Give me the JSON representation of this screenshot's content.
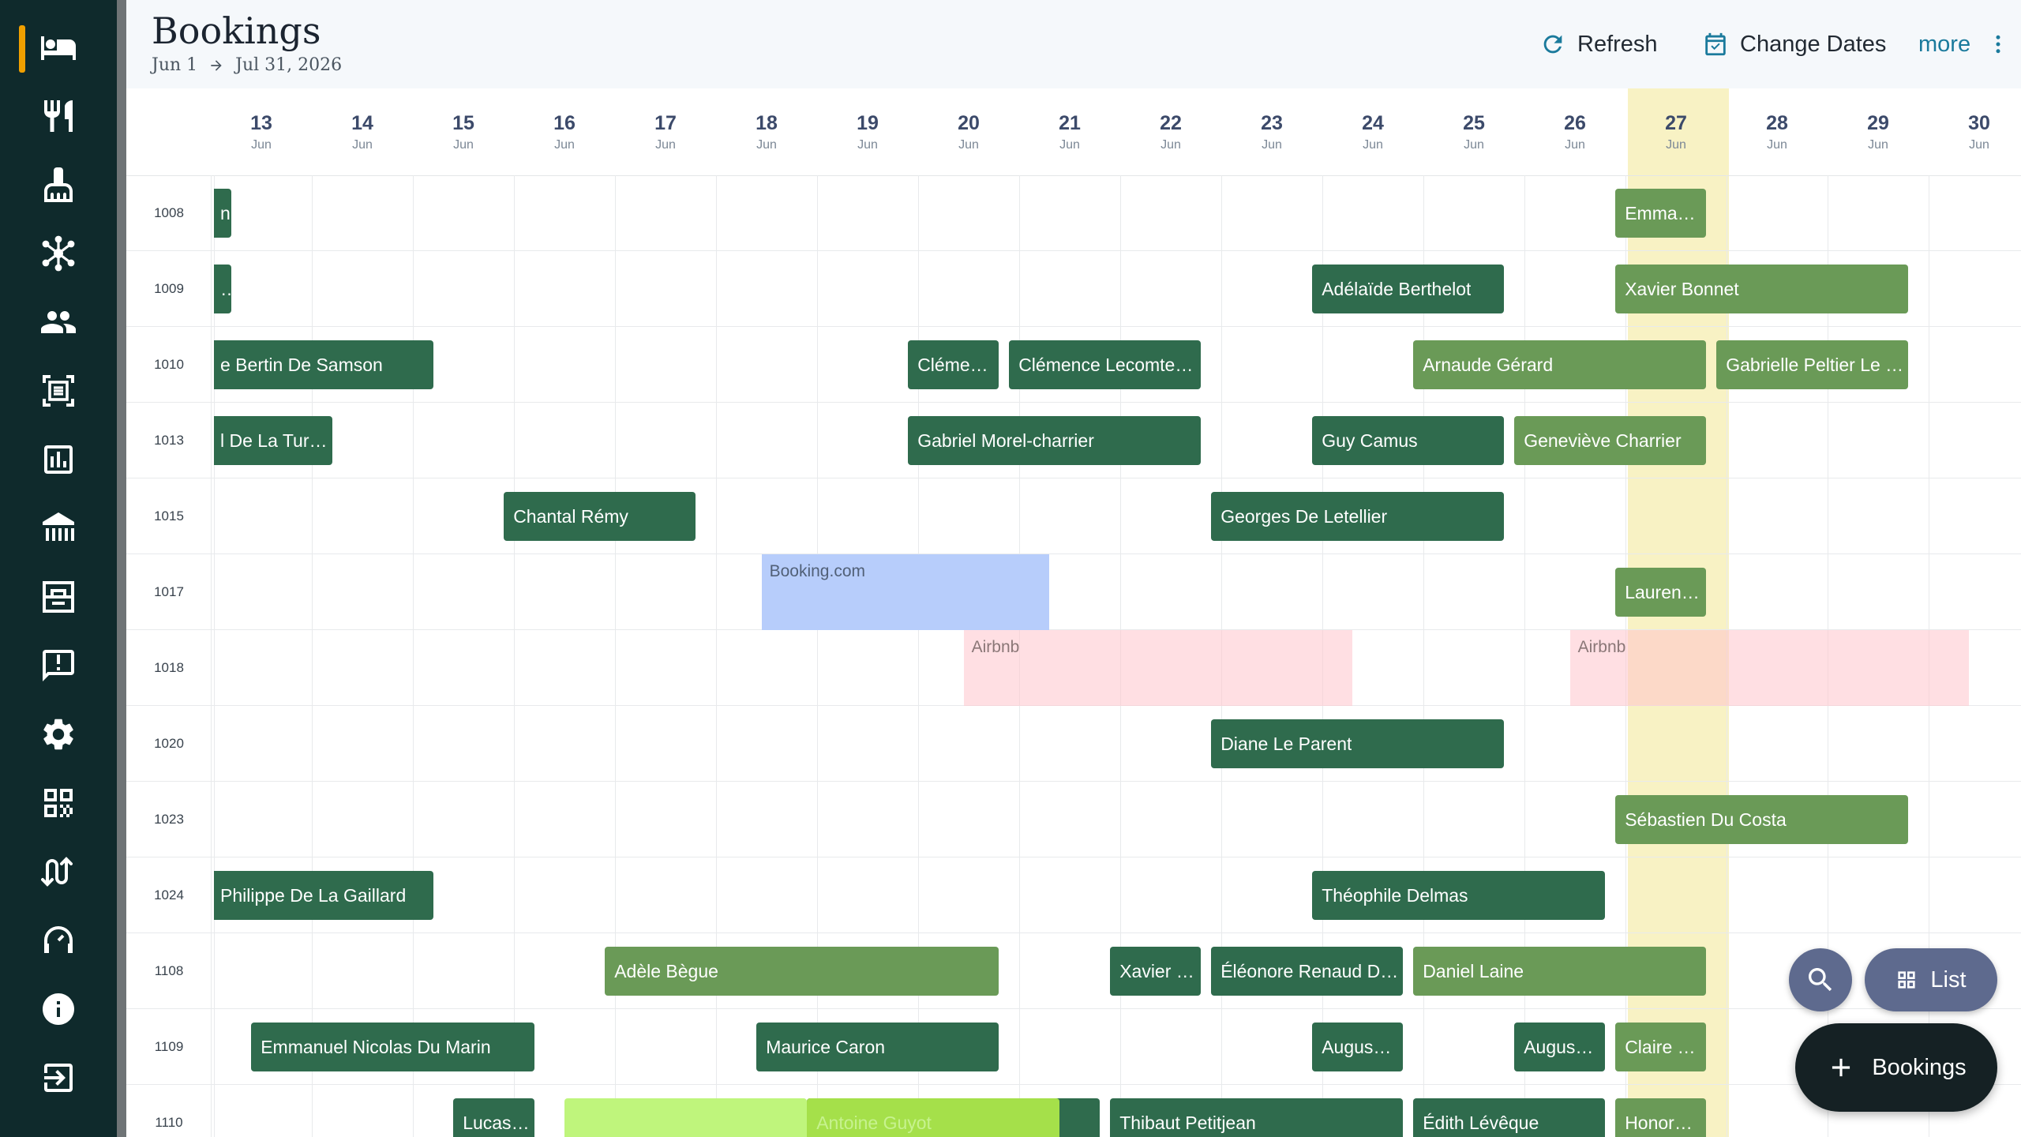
{
  "header": {
    "title": "Bookings",
    "date_start": "Jun 1",
    "date_end": "Jul 31, 2026",
    "refresh_label": "Refresh",
    "change_dates_label": "Change Dates",
    "more_label": "more"
  },
  "sidebar": {
    "items": [
      {
        "icon": "bed-icon",
        "active": true
      },
      {
        "icon": "restaurant-icon"
      },
      {
        "icon": "cleaning-icon"
      },
      {
        "icon": "hub-icon"
      },
      {
        "icon": "guests-icon"
      },
      {
        "icon": "document-scan-icon"
      },
      {
        "icon": "reports-icon"
      },
      {
        "icon": "property-icon"
      },
      {
        "icon": "rooms-icon"
      },
      {
        "icon": "feedback-icon"
      },
      {
        "icon": "settings-icon"
      },
      {
        "icon": "qr-code-icon"
      },
      {
        "icon": "channel-icon"
      },
      {
        "icon": "support-icon"
      },
      {
        "icon": "info-icon"
      },
      {
        "icon": "logout-icon"
      }
    ]
  },
  "days": [
    {
      "num": "13",
      "mon": "Jun"
    },
    {
      "num": "14",
      "mon": "Jun"
    },
    {
      "num": "15",
      "mon": "Jun"
    },
    {
      "num": "16",
      "mon": "Jun"
    },
    {
      "num": "17",
      "mon": "Jun"
    },
    {
      "num": "18",
      "mon": "Jun"
    },
    {
      "num": "19",
      "mon": "Jun"
    },
    {
      "num": "20",
      "mon": "Jun"
    },
    {
      "num": "21",
      "mon": "Jun"
    },
    {
      "num": "22",
      "mon": "Jun"
    },
    {
      "num": "23",
      "mon": "Jun"
    },
    {
      "num": "24",
      "mon": "Jun"
    },
    {
      "num": "25",
      "mon": "Jun"
    },
    {
      "num": "26",
      "mon": "Jun"
    },
    {
      "num": "27",
      "mon": "Jun",
      "today": true
    },
    {
      "num": "28",
      "mon": "Jun"
    },
    {
      "num": "29",
      "mon": "Jun"
    },
    {
      "num": "30",
      "mon": "Jun"
    }
  ],
  "rooms": [
    "1008",
    "1009",
    "1010",
    "1013",
    "1015",
    "1017",
    "1018",
    "1020",
    "1023",
    "1024",
    "1108",
    "1109",
    "1110"
  ],
  "bookings": [
    {
      "row": 0,
      "start": 12.5,
      "end": 12.7,
      "name": "n",
      "style": "dark"
    },
    {
      "row": 0,
      "start": 26.4,
      "end": 27.3,
      "name": "Emma…",
      "style": "light"
    },
    {
      "row": 1,
      "start": 12.5,
      "end": 12.7,
      "name": "…",
      "style": "dark"
    },
    {
      "row": 1,
      "start": 23.4,
      "end": 25.3,
      "name": "Adélaïde Berthelot",
      "style": "dark"
    },
    {
      "row": 1,
      "start": 26.4,
      "end": 29.3,
      "name": "Xavier Bonnet",
      "style": "light"
    },
    {
      "row": 2,
      "start": 12.5,
      "end": 14.7,
      "name": "e Bertin De Samson",
      "style": "dark"
    },
    {
      "row": 2,
      "start": 19.4,
      "end": 20.3,
      "name": "Cléme…",
      "style": "dark"
    },
    {
      "row": 2,
      "start": 20.4,
      "end": 22.3,
      "name": "Clémence Lecomte…",
      "style": "dark"
    },
    {
      "row": 2,
      "start": 24.4,
      "end": 27.3,
      "name": "Arnaude Gérard",
      "style": "light"
    },
    {
      "row": 2,
      "start": 27.4,
      "end": 29.3,
      "name": "Gabrielle Peltier Le …",
      "style": "light"
    },
    {
      "row": 3,
      "start": 12.5,
      "end": 13.7,
      "name": "l De La Turpin",
      "style": "dark"
    },
    {
      "row": 3,
      "start": 19.4,
      "end": 22.3,
      "name": "Gabriel Morel-charrier",
      "style": "dark"
    },
    {
      "row": 3,
      "start": 23.4,
      "end": 25.3,
      "name": "Guy Camus",
      "style": "dark"
    },
    {
      "row": 3,
      "start": 25.4,
      "end": 27.3,
      "name": "Geneviève Charrier",
      "style": "light"
    },
    {
      "row": 4,
      "start": 15.4,
      "end": 17.3,
      "name": "Chantal Rémy",
      "style": "dark"
    },
    {
      "row": 4,
      "start": 22.4,
      "end": 25.3,
      "name": "Georges De Letellier",
      "style": "dark"
    },
    {
      "row": 5,
      "start": 26.4,
      "end": 27.3,
      "name": "Lauren…",
      "style": "light"
    },
    {
      "row": 7,
      "start": 22.4,
      "end": 25.3,
      "name": "Diane Le Parent",
      "style": "dark"
    },
    {
      "row": 8,
      "start": 26.4,
      "end": 29.3,
      "name": "Sébastien Du Costa",
      "style": "light"
    },
    {
      "row": 9,
      "start": 12.5,
      "end": 14.7,
      "name": "Philippe De La Gaillard",
      "style": "dark"
    },
    {
      "row": 9,
      "start": 23.4,
      "end": 26.3,
      "name": "Théophile Delmas",
      "style": "dark"
    },
    {
      "row": 10,
      "start": 16.4,
      "end": 20.3,
      "name": "Adèle Bègue",
      "style": "light"
    },
    {
      "row": 10,
      "start": 21.4,
      "end": 22.3,
      "name": "Xavier …",
      "style": "dark"
    },
    {
      "row": 10,
      "start": 22.4,
      "end": 24.3,
      "name": "Éléonore Renaud D…",
      "style": "dark"
    },
    {
      "row": 10,
      "start": 24.4,
      "end": 27.3,
      "name": "Daniel Laine",
      "style": "light"
    },
    {
      "row": 11,
      "start": 12.9,
      "end": 15.7,
      "name": "Emmanuel Nicolas Du Marin",
      "style": "dark"
    },
    {
      "row": 11,
      "start": 17.9,
      "end": 20.3,
      "name": "Maurice Caron",
      "style": "dark"
    },
    {
      "row": 11,
      "start": 23.4,
      "end": 24.3,
      "name": "Augus…",
      "style": "dark"
    },
    {
      "row": 11,
      "start": 25.4,
      "end": 26.3,
      "name": "Augus…",
      "style": "dark"
    },
    {
      "row": 11,
      "start": 26.4,
      "end": 27.3,
      "name": "Claire …",
      "style": "light"
    },
    {
      "row": 12,
      "start": 14.9,
      "end": 15.7,
      "name": "Lucas-…",
      "style": "dark"
    },
    {
      "row": 12,
      "start": 18.4,
      "end": 21.3,
      "name": "",
      "style": "dark"
    },
    {
      "row": 12,
      "start": 16.0,
      "end": 18.4,
      "name": "",
      "style": "lime2"
    },
    {
      "row": 12,
      "start": 18.4,
      "end": 20.9,
      "name": "Antoine Guyot",
      "style": "lime"
    },
    {
      "row": 12,
      "start": 21.4,
      "end": 24.3,
      "name": "Thibaut Petitjean",
      "style": "dark"
    },
    {
      "row": 12,
      "start": 24.4,
      "end": 26.3,
      "name": "Édith Lévêque",
      "style": "dark"
    },
    {
      "row": 12,
      "start": 26.4,
      "end": 27.3,
      "name": "Honor…",
      "style": "light"
    }
  ],
  "blocks": [
    {
      "row": 5,
      "start": 17.95,
      "end": 20.8,
      "label": "Booking.com",
      "style": "bk"
    },
    {
      "row": 6,
      "start": 19.95,
      "end": 23.8,
      "label": "Airbnb",
      "style": "ab"
    },
    {
      "row": 6,
      "start": 25.95,
      "end": 29.9,
      "label": "Airbnb",
      "style": "ab"
    }
  ],
  "fab": {
    "list_label": "List",
    "add_label": "Bookings"
  }
}
